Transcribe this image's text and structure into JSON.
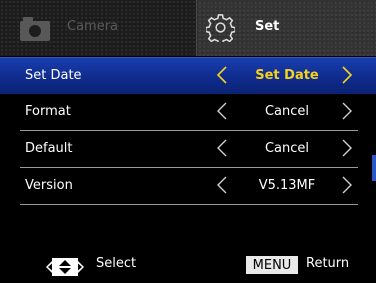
{
  "tabs": {
    "camera": {
      "label": "Camera",
      "icon": "camera-icon"
    },
    "set": {
      "label": "Set",
      "icon": "gear-icon"
    }
  },
  "menu": {
    "items": [
      {
        "label": "Set Date",
        "value": "Set Date",
        "selected": true
      },
      {
        "label": "Format",
        "value": "Cancel",
        "selected": false
      },
      {
        "label": "Default",
        "value": "Cancel",
        "selected": false
      },
      {
        "label": "Version",
        "value": "V5.13MF",
        "selected": false
      }
    ]
  },
  "footer": {
    "select_label": "Select",
    "menu_key": "MENU",
    "return_label": "Return",
    "select_icon": "dpad-icon"
  },
  "colors": {
    "selected_row": "#1a3fb0",
    "selected_value": "#f5d21c",
    "background": "#000000"
  }
}
